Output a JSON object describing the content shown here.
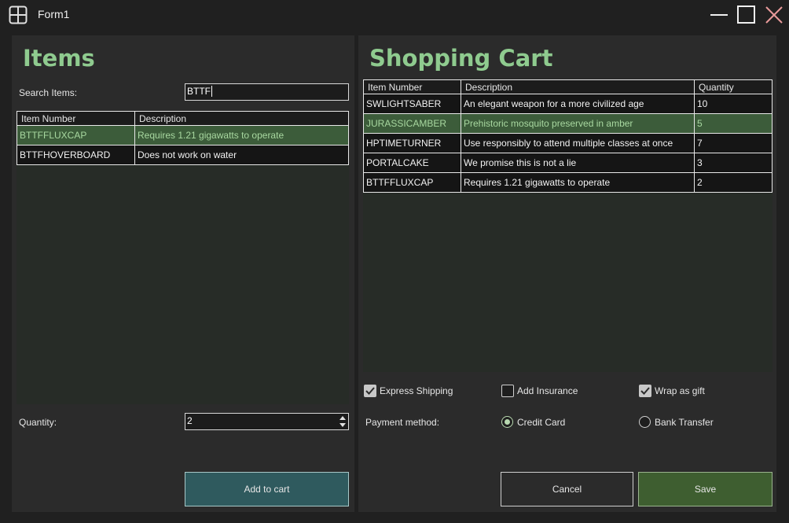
{
  "window": {
    "title": "Form1",
    "icon": "grid-app-icon"
  },
  "left": {
    "heading": "Items",
    "search_label": "Search Items:",
    "search_value": "BTTF",
    "columns": [
      "Item Number",
      "Description"
    ],
    "rows": [
      {
        "item": "BTTFFLUXCAP",
        "desc": "Requires 1.21 gigawatts to operate",
        "selected": true
      },
      {
        "item": "BTTFHOVERBOARD",
        "desc": "Does not work on water",
        "selected": false
      }
    ],
    "quantity_label": "Quantity:",
    "quantity_value": "2",
    "add_button": "Add to cart"
  },
  "right": {
    "heading": "Shopping Cart",
    "columns": [
      "Item Number",
      "Description",
      "Quantity"
    ],
    "rows": [
      {
        "item": "SWLIGHTSABER",
        "desc": "An elegant weapon for a more civilized age",
        "qty": "10",
        "selected": false
      },
      {
        "item": "JURASSICAMBER",
        "desc": "Prehistoric mosquito preserved in amber",
        "qty": "5",
        "selected": true
      },
      {
        "item": "HPTIMETURNER",
        "desc": "Use responsibly to attend multiple classes at once",
        "qty": "7",
        "selected": false
      },
      {
        "item": "PORTALCAKE",
        "desc": "We promise this is not a lie",
        "qty": "3",
        "selected": false
      },
      {
        "item": "BTTFFLUXCAP",
        "desc": "Requires 1.21 gigawatts to operate",
        "qty": "2",
        "selected": false
      }
    ],
    "options": {
      "express_shipping": {
        "label": "Express Shipping",
        "checked": true
      },
      "add_insurance": {
        "label": "Add Insurance",
        "checked": false
      },
      "wrap_as_gift": {
        "label": "Wrap as gift",
        "checked": true
      }
    },
    "payment_label": "Payment method:",
    "payment": {
      "credit_card": {
        "label": "Credit Card",
        "selected": true
      },
      "bank_transfer": {
        "label": "Bank Transfer",
        "selected": false
      }
    },
    "cancel_button": "Cancel",
    "save_button": "Save"
  },
  "colors": {
    "accent_green": "#8fcb8f",
    "selected_row": "#3c5c3a",
    "add_button": "#2f5a5e",
    "save_button": "#3e5e30"
  }
}
